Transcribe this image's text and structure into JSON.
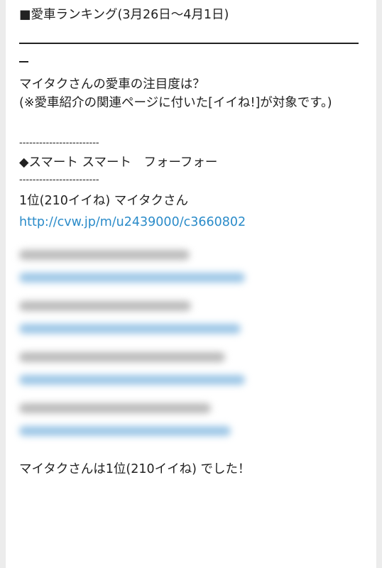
{
  "ranking": {
    "title": "■愛車ランキング(3月26日〜4月1日)",
    "question": "マイタクさんの愛車の注目度は？",
    "note": "(※愛車紹介の関連ページに付いた[イイね!]が対象です。)",
    "separator": "------------------------",
    "car_name": "◆スマート スマート　フォーフォー",
    "entries": [
      {
        "rank_text": "1位(210イイね) マイタクさん",
        "url": "http://cvw.jp/m/u2439000/c3660802"
      }
    ],
    "conclusion": "マイタクさんは1位(210イイね) でした！"
  },
  "colors": {
    "link": "#2a8bc9",
    "text": "#222222",
    "background": "#ececec",
    "panel": "#ffffff"
  }
}
